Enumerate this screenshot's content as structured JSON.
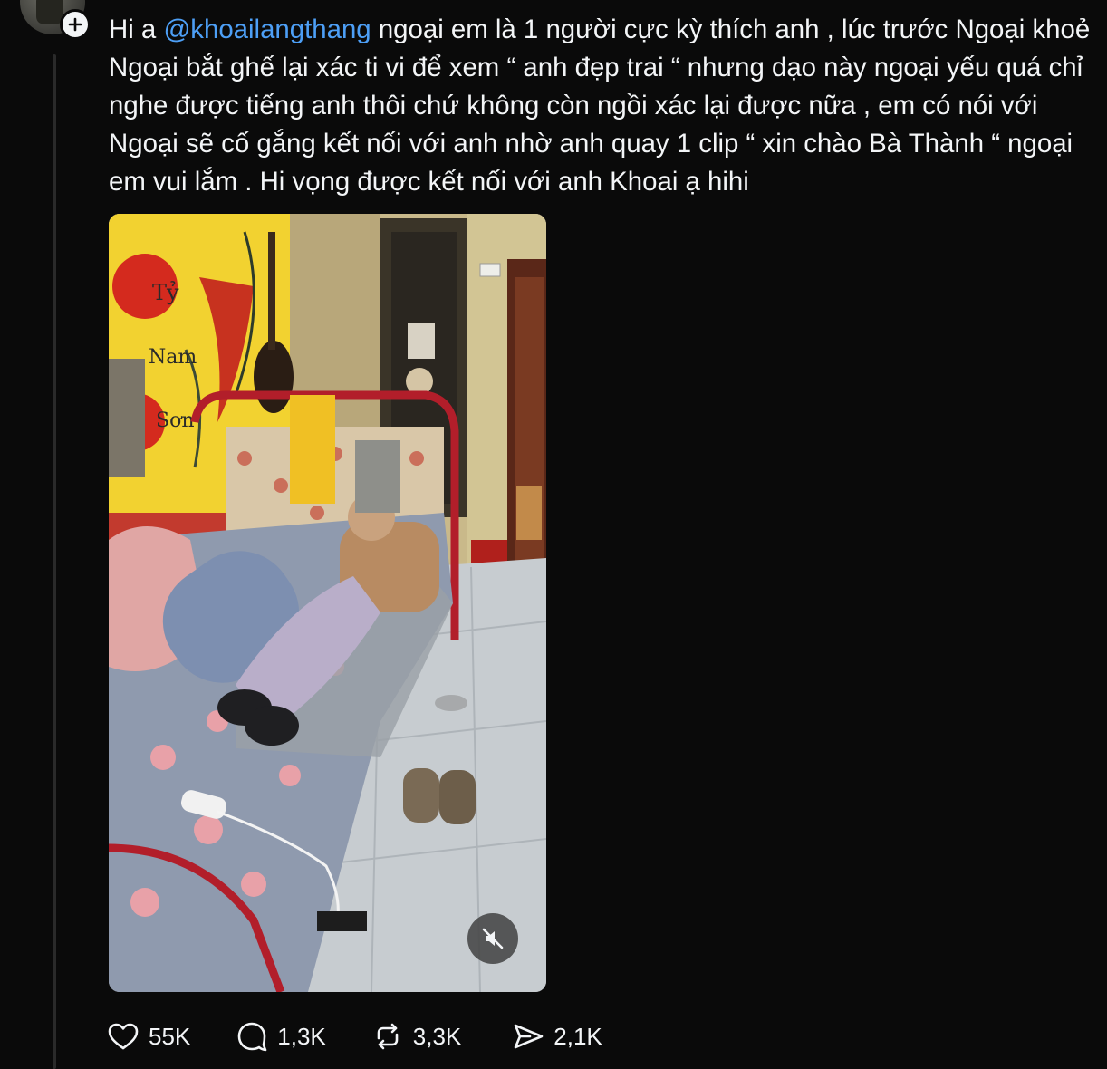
{
  "post": {
    "caption_prefix": "Hi a ",
    "mention": "@khoailangthang",
    "caption_body": " ngoại em là 1 người cực kỳ thích anh , lúc trước Ngoại khoẻ Ngoại bắt ghế lại xác ti vi để xem “ anh đẹp trai “ nhưng dạo này ngoại yếu quá chỉ nghe được tiếng anh thôi chứ không còn ngồi xác lại được nữa , em có nói với Ngoại sẽ cố gắng kết nối với anh nhờ anh quay 1 clip “ xin chào Bà Thành “ ngoại em vui lắm . Hi vọng được kết nối với anh Khoai ạ hihi"
  },
  "media": {
    "wall_text_lines": [
      "Tỷ",
      "Nam",
      "Sơn"
    ],
    "mute_icon": "speaker-muted-icon"
  },
  "actions": {
    "like_count": "55K",
    "reply_count": "1,3K",
    "repost_count": "3,3K",
    "share_count": "2,1K"
  },
  "colors": {
    "background": "#0a0a0a",
    "text": "#f3f5f7",
    "mention": "#4d9ff6",
    "thread_line": "#2a2a2a"
  }
}
